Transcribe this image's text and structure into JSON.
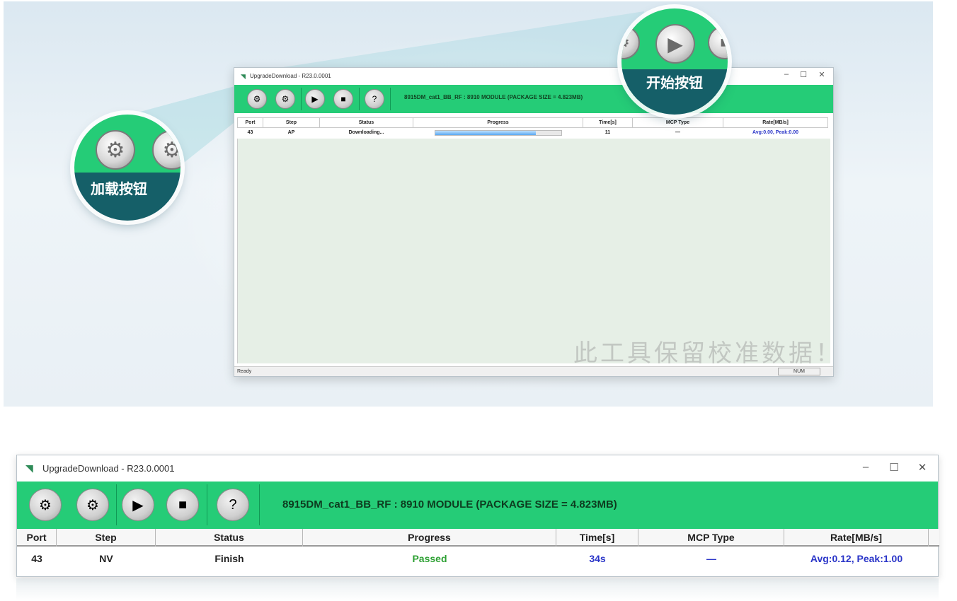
{
  "top": {
    "window_title": "UpgradeDownload - R23.0.0001",
    "package_info": "8915DM_cat1_BB_RF : 8910 MODULE (PACKAGE SIZE = 4.823MB)",
    "columns": [
      "Port",
      "Step",
      "Status",
      "Progress",
      "Time[s]",
      "MCP Type",
      "Rate[MB/s]"
    ],
    "row": {
      "port": "43",
      "step": "AP",
      "status": "Downloading...",
      "progress": 0.8,
      "time": "11",
      "mcp_type": "—",
      "rate": "Avg:0.00, Peak:0.00"
    },
    "status_left": "Ready",
    "status_right": "NUM",
    "watermark": "此工具保留校准数据！",
    "callout_load": "加载按钮",
    "callout_start": "开始按钮"
  },
  "bottom": {
    "window_title": "UpgradeDownload - R23.0.0001",
    "package_info": "8915DM_cat1_BB_RF : 8910 MODULE (PACKAGE SIZE = 4.823MB)",
    "columns": [
      "Port",
      "Step",
      "Status",
      "Progress",
      "Time[s]",
      "MCP Type",
      "Rate[MB/s]"
    ],
    "row": {
      "port": "43",
      "step": "NV",
      "status": "Finish",
      "progress": "Passed",
      "time": "34s",
      "mcp_type": "—",
      "rate": "Avg:0.12, Peak:1.00"
    }
  },
  "window_controls": {
    "minimize": "–",
    "maximize": "☐",
    "close": "✕"
  },
  "icons": {
    "load": "gear-icon",
    "settings": "gears-icon",
    "start": "play-icon",
    "stop": "stop-icon",
    "help": "help-icon",
    "app": "app-logo-icon"
  },
  "colors": {
    "toolbar_green": "#25cc77",
    "callout_teal": "#155f68",
    "passed_green": "#2da033",
    "value_blue": "#2a35c8"
  }
}
